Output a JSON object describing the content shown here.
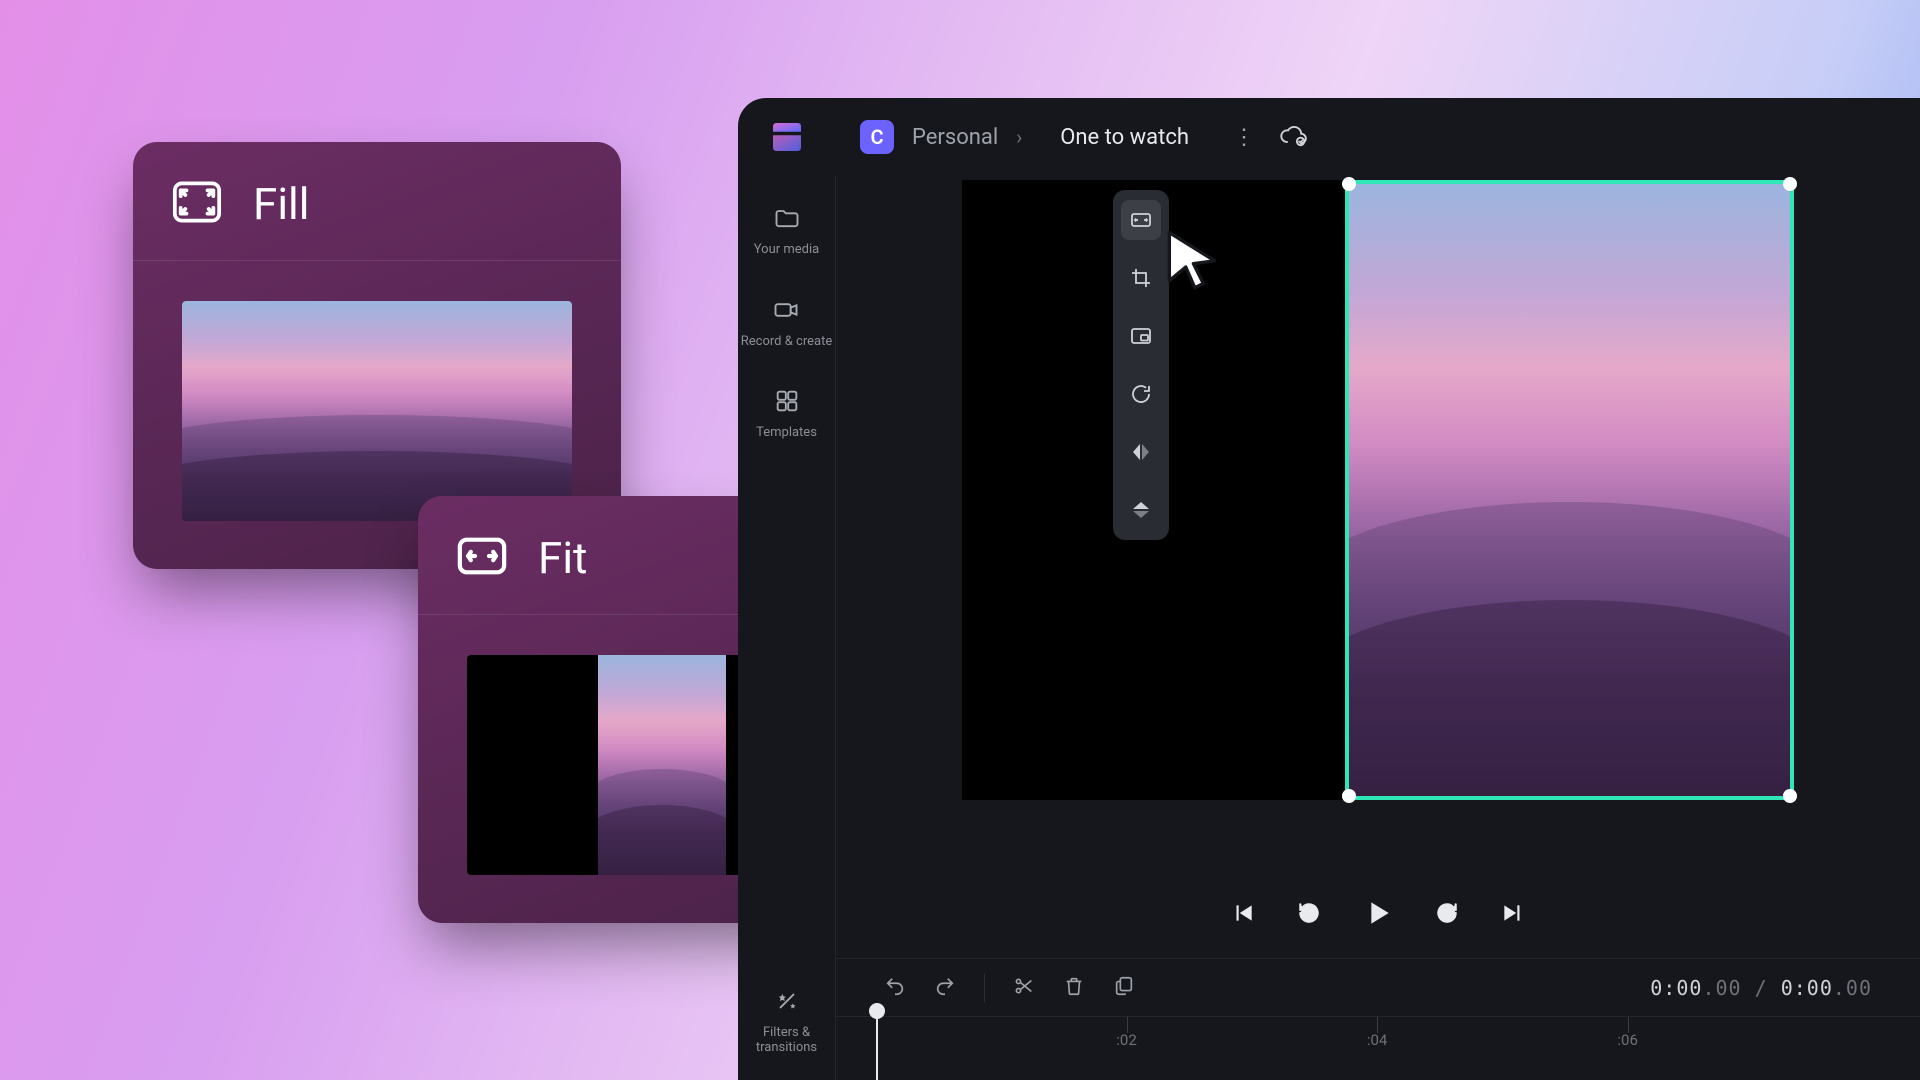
{
  "cards": {
    "fill": {
      "label": "Fill"
    },
    "fit": {
      "label": "Fit"
    }
  },
  "breadcrumb": {
    "workspace_badge": "C",
    "workspace_name": "Personal",
    "project_name": "One to watch"
  },
  "sidebar": {
    "items": [
      {
        "label": "Your media"
      },
      {
        "label": "Record & create"
      },
      {
        "label": "Templates"
      }
    ],
    "bottom": {
      "label": "Filters &\ntransitions"
    }
  },
  "floating_tools": [
    {
      "name": "fit-icon"
    },
    {
      "name": "crop-icon"
    },
    {
      "name": "pip-icon"
    },
    {
      "name": "rotate-icon"
    },
    {
      "name": "flip-horizontal-icon"
    },
    {
      "name": "flip-vertical-icon"
    }
  ],
  "playback": [
    "previous",
    "rewind",
    "play",
    "forward",
    "next"
  ],
  "timecode": {
    "current": "0:00",
    "current_frac": ".00",
    "total": "0:00",
    "total_frac": ".00"
  },
  "timeline": {
    "ticks": [
      ":02",
      ":04",
      ":06"
    ]
  },
  "colors": {
    "selection": "#2ee6b6",
    "accent": "#6c63ff"
  }
}
